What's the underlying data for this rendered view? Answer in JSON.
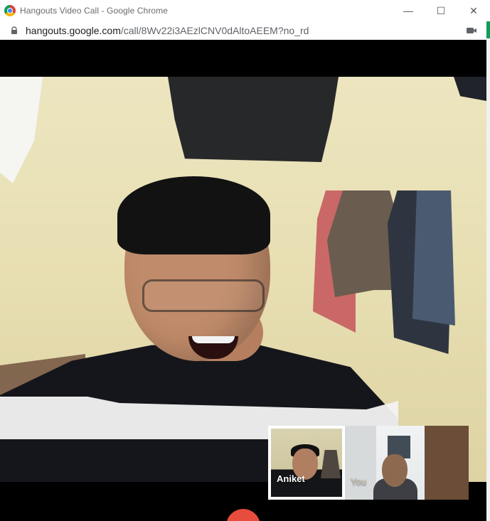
{
  "window": {
    "title": "Hangouts Video Call - Google Chrome",
    "controls": {
      "minimize": "—",
      "maximize": "☐",
      "close": "✕"
    }
  },
  "address_bar": {
    "url_domain": "hangouts.google.com",
    "url_path": "/call/8Wv22i3AEzlCNV0dAltoAEEM?no_rd"
  },
  "call": {
    "thumbnails": [
      {
        "label": "Aniket",
        "selected": true
      },
      {
        "label": "You",
        "selected": false
      }
    ]
  },
  "icons": {
    "app": "chrome-icon",
    "lock": "lock-icon",
    "camera": "video-camera-icon",
    "end_call": "end-call-icon"
  },
  "colors": {
    "accent_green": "#0f9d58",
    "end_call_red": "#e74c3c"
  }
}
